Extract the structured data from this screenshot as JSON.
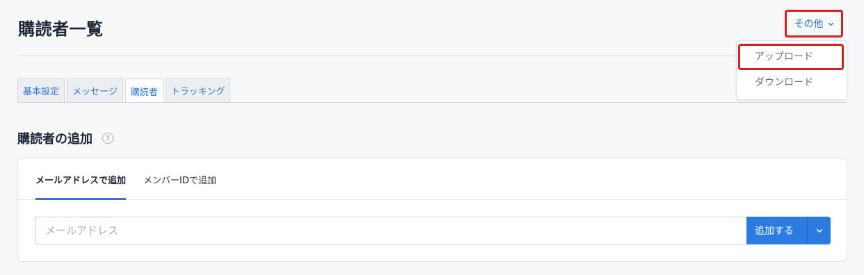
{
  "header": {
    "title": "購読者一覧",
    "more_label": "その他"
  },
  "more_menu": {
    "items": [
      "アップロード",
      "ダウンロード"
    ],
    "highlighted": "アップロード"
  },
  "tabs": [
    {
      "label": "基本設定",
      "active": false
    },
    {
      "label": "メッセージ",
      "active": false
    },
    {
      "label": "購読者",
      "active": true
    },
    {
      "label": "トラッキング",
      "active": false
    }
  ],
  "section": {
    "title": "購読者の追加",
    "help_icon": "question-circle-icon"
  },
  "add_card": {
    "subtabs": [
      {
        "label": "メールアドレスで追加",
        "active": true
      },
      {
        "label": "メンバーIDで追加",
        "active": false
      }
    ],
    "email_placeholder": "メールアドレス",
    "email_value": "",
    "add_label": "追加する"
  },
  "colors": {
    "accent": "#2b7be0",
    "highlight": "#d81f1f",
    "background": "#f7f8fa"
  }
}
